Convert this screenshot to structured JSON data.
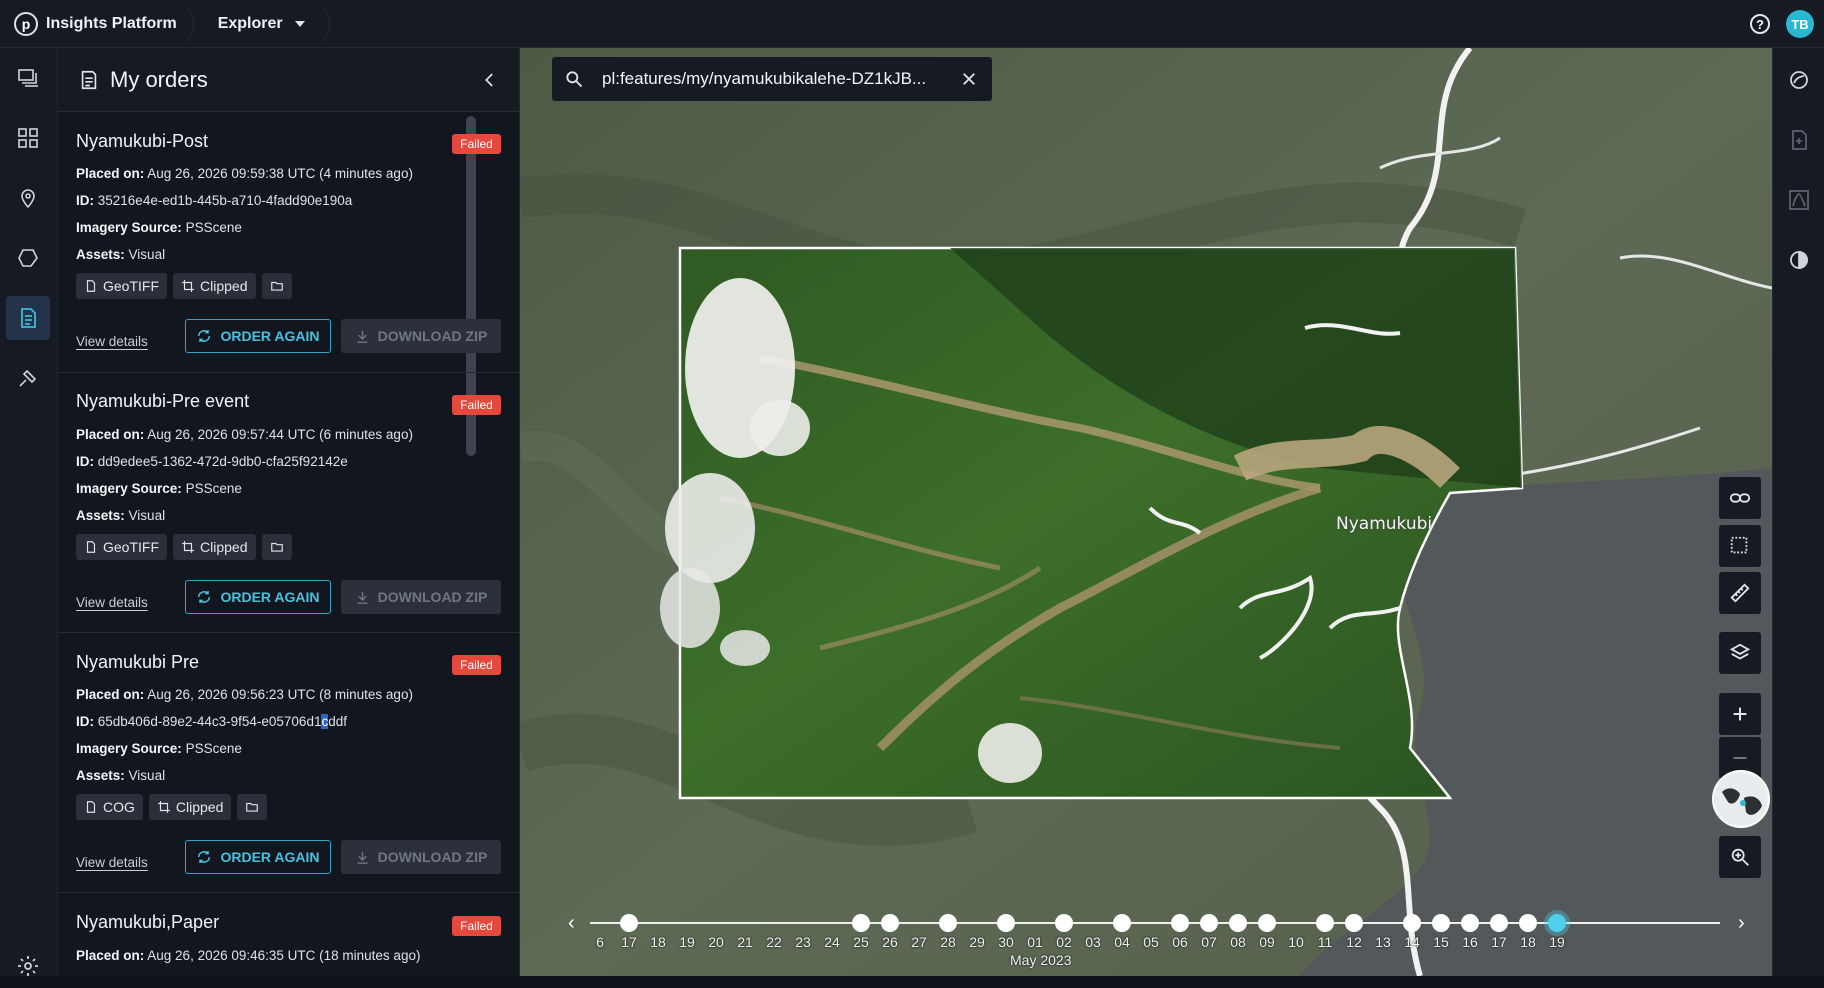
{
  "brand": {
    "name": "Insights Platform",
    "logo_letter": "p"
  },
  "app_switcher": {
    "label": "Explorer"
  },
  "user": {
    "initials": "TB",
    "avatar_color": "#2bb7d2"
  },
  "panel": {
    "title": "My orders"
  },
  "labels": {
    "placed_on": "Placed on:",
    "id": "ID:",
    "imagery_source": "Imagery Source:",
    "assets": "Assets:",
    "view_details": "View details",
    "order_again": "ORDER AGAIN",
    "download_zip": "DOWNLOAD ZIP"
  },
  "orders": [
    {
      "name": "Nyamukubi-Post",
      "status": "Failed",
      "placed_on": "Aug 26, 2026 09:59:38 UTC (4 minutes ago)",
      "id": "35216e4e-ed1b-445b-a710-4fadd90e190a",
      "imagery_source": "PSScene",
      "assets": "Visual",
      "format": "GeoTIFF",
      "clip": "Clipped"
    },
    {
      "name": "Nyamukubi-Pre event",
      "status": "Failed",
      "placed_on": "Aug 26, 2026 09:57:44 UTC (6 minutes ago)",
      "id": "dd9edee5-1362-472d-9db0-cfa25f92142e",
      "imagery_source": "PSScene",
      "assets": "Visual",
      "format": "GeoTIFF",
      "clip": "Clipped"
    },
    {
      "name": "Nyamukubi Pre",
      "status": "Failed",
      "placed_on": "Aug 26, 2026 09:56:23 UTC (8 minutes ago)",
      "id_a": "65db406d-89e2-44c3-9f54-e05706d1",
      "id_sel": "c",
      "id_b": "ddf",
      "imagery_source": "PSScene",
      "assets": "Visual",
      "format": "COG",
      "clip": "Clipped"
    },
    {
      "name": "Nyamukubi,Paper",
      "status": "Failed",
      "placed_on": "Aug 26, 2026 09:46:35 UTC (18 minutes ago)"
    }
  ],
  "search": {
    "query": "pl:features/my/nyamukubikalehe-DZ1kJB..."
  },
  "map": {
    "place_label": "Nyamukubi"
  },
  "timeline": {
    "month": "May 2023",
    "days": [
      "6",
      "17",
      "18",
      "19",
      "20",
      "21",
      "22",
      "23",
      "24",
      "25",
      "26",
      "27",
      "28",
      "29",
      "30",
      "01",
      "02",
      "03",
      "04",
      "05",
      "06",
      "07",
      "08",
      "09",
      "10",
      "11",
      "12",
      "13",
      "14",
      "15",
      "16",
      "17",
      "18",
      "19"
    ],
    "active_day": "19"
  },
  "colors": {
    "accent": "#2ea6c6",
    "failed": "#e5483d",
    "panel_bg": "#12161e"
  }
}
